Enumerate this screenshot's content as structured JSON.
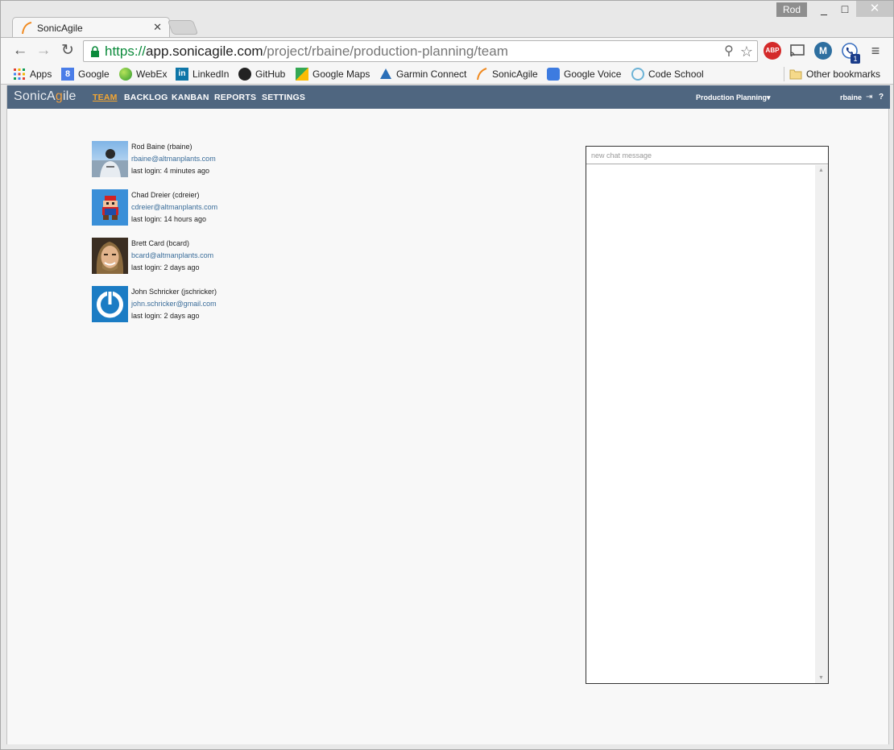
{
  "browser": {
    "user_badge": "Rod",
    "tab_title": "SonicAgile",
    "url_scheme": "https://",
    "url_host": "app.sonicagile.com",
    "url_path": "/project/rbaine/production-planning/team",
    "window_controls": {
      "minimize": "_",
      "maximize": "□",
      "close": "✕"
    }
  },
  "bookmarks": [
    {
      "label": "Apps",
      "icon": "apps-grid-icon"
    },
    {
      "label": "Google",
      "icon": "google-icon"
    },
    {
      "label": "WebEx",
      "icon": "webex-icon"
    },
    {
      "label": "LinkedIn",
      "icon": "linkedin-icon"
    },
    {
      "label": "GitHub",
      "icon": "github-icon"
    },
    {
      "label": "Google Maps",
      "icon": "maps-icon"
    },
    {
      "label": "Garmin Connect",
      "icon": "garmin-icon"
    },
    {
      "label": "SonicAgile",
      "icon": "sonicagile-icon"
    },
    {
      "label": "Google Voice",
      "icon": "voice-icon"
    },
    {
      "label": "Code School",
      "icon": "codeschool-icon"
    },
    {
      "label": "Other bookmarks",
      "icon": "folder-icon"
    }
  ],
  "app": {
    "logo_prefix": "SonicA",
    "logo_accent": "g",
    "logo_suffix": "ile",
    "nav": [
      {
        "label": "TEAM",
        "active": true
      },
      {
        "label": "BACKLOG",
        "active": false
      },
      {
        "label": "KANBAN",
        "active": false
      },
      {
        "label": "REPORTS",
        "active": false
      },
      {
        "label": "SETTINGS",
        "active": false
      }
    ],
    "project_selector": "Production Planning",
    "username": "rbaine",
    "help_label": "?"
  },
  "team": [
    {
      "name": "Rod Baine (rbaine)",
      "email": "rbaine@altmanplants.com",
      "last_login": "last login: 4 minutes ago"
    },
    {
      "name": "Chad Dreier (cdreier)",
      "email": "cdreier@altmanplants.com",
      "last_login": "last login: 14 hours ago"
    },
    {
      "name": "Brett Card (bcard)",
      "email": "bcard@altmanplants.com",
      "last_login": "last login: 2 days ago"
    },
    {
      "name": "John Schricker (jschricker)",
      "email": "john.schricker@gmail.com",
      "last_login": "last login: 2 days ago"
    }
  ],
  "chat": {
    "placeholder": "new chat message",
    "messages": []
  },
  "colors": {
    "appbar": "#4f6680",
    "active_nav": "#f5a732",
    "link": "#3a6d9a",
    "https_green": "#0b8a3b"
  }
}
